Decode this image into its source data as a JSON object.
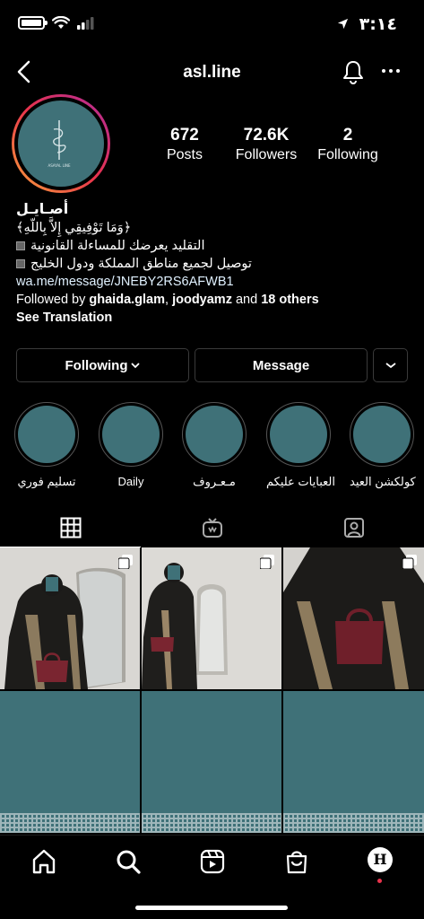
{
  "status_bar": {
    "time": "٣:١٤"
  },
  "nav": {
    "title": "asl.line"
  },
  "profile": {
    "avatar_caption": "ASAYAL LINE",
    "stats": [
      {
        "value": "672",
        "label": "Posts"
      },
      {
        "value": "72.6K",
        "label": "Followers"
      },
      {
        "value": "2",
        "label": "Following"
      }
    ],
    "display_name": "أصـايـل",
    "bio_lines": [
      "﴿وَمَا تَوْفِيقِي إِلاَّ بِاللّهِ﴾",
      "التقليد يعرضك للمساءلة القانونية",
      "توصيل لجميع مناطق المملكة ودول الخليج"
    ],
    "link": "wa.me/message/JNEBY2RS6AFWB1",
    "followed_by_prefix": "Followed by ",
    "followed_by_user1": "ghaida.glam",
    "followed_by_sep": ", ",
    "followed_by_user2": "joodyamz",
    "followed_by_and": " and ",
    "followed_by_others": "18 others",
    "see_translation": "See Translation"
  },
  "buttons": {
    "following": "Following",
    "message": "Message"
  },
  "highlights": [
    "كولكشن العيد",
    "العبايات عليكم",
    "مـعـروف",
    "Daily",
    "تسليم فوري"
  ],
  "colors": {
    "brand_teal": "#3f7178",
    "accent_red": "#e8334c",
    "link": "#e0f1ff"
  },
  "bottom_nav": {
    "profile_initial": "H"
  }
}
